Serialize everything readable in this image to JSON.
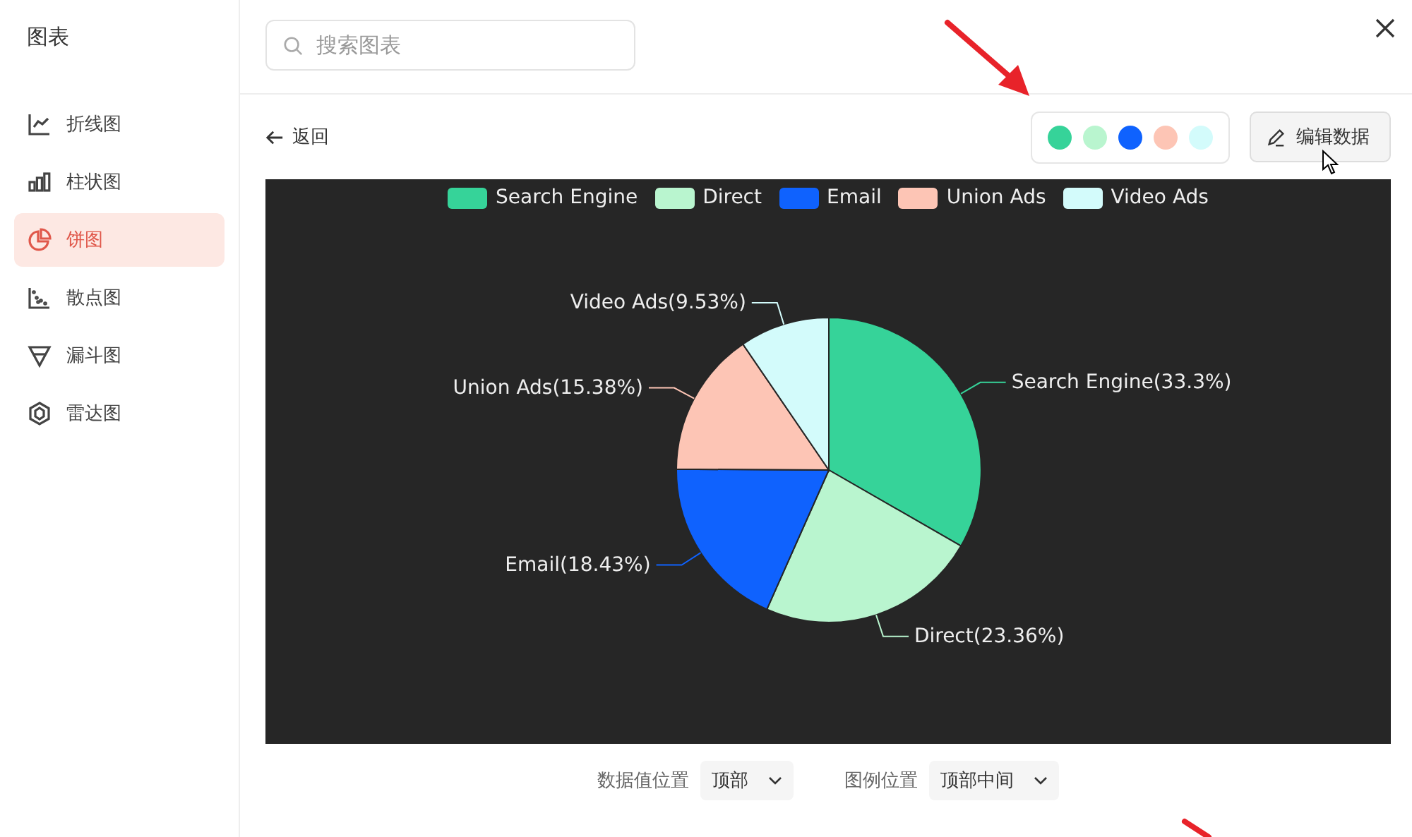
{
  "sidebar": {
    "title": "图表",
    "items": [
      {
        "kind": "line",
        "label": "折线图",
        "selected": false
      },
      {
        "kind": "bar",
        "label": "柱状图",
        "selected": false
      },
      {
        "kind": "pie",
        "label": "饼图",
        "selected": true
      },
      {
        "kind": "scatter",
        "label": "散点图",
        "selected": false
      },
      {
        "kind": "funnel",
        "label": "漏斗图",
        "selected": false
      },
      {
        "kind": "radar",
        "label": "雷达图",
        "selected": false
      }
    ]
  },
  "search": {
    "placeholder": "搜索图表"
  },
  "toolbar": {
    "back": "返回",
    "palette": [
      {
        "color": "#36d399"
      },
      {
        "color": "#b9f5cf"
      },
      {
        "color": "#0f62fe"
      },
      {
        "color": "#fdc5b5"
      },
      {
        "color": "#d3fbfb"
      }
    ],
    "edit_button": "编辑数据"
  },
  "chart_data": {
    "type": "pie",
    "categories": [
      "Search Engine",
      "Direct",
      "Email",
      "Union Ads",
      "Video Ads"
    ],
    "values": [
      33.3,
      23.36,
      18.43,
      15.38,
      9.53
    ],
    "legend": "top",
    "colors": [
      "#36d399",
      "#b9f5cf",
      "#0f62fe",
      "#fdc5b5",
      "#d3fbfb"
    ],
    "value_labels": [
      "Search Engine(33.3%)",
      "Direct(23.36%)",
      "Email(18.43%)",
      "Union Ads(15.38%)",
      "Video Ads(9.53%)"
    ]
  },
  "options": [
    {
      "label": "数据值位置",
      "value": "顶部"
    },
    {
      "label": "图例位置",
      "value": "顶部中间"
    }
  ]
}
